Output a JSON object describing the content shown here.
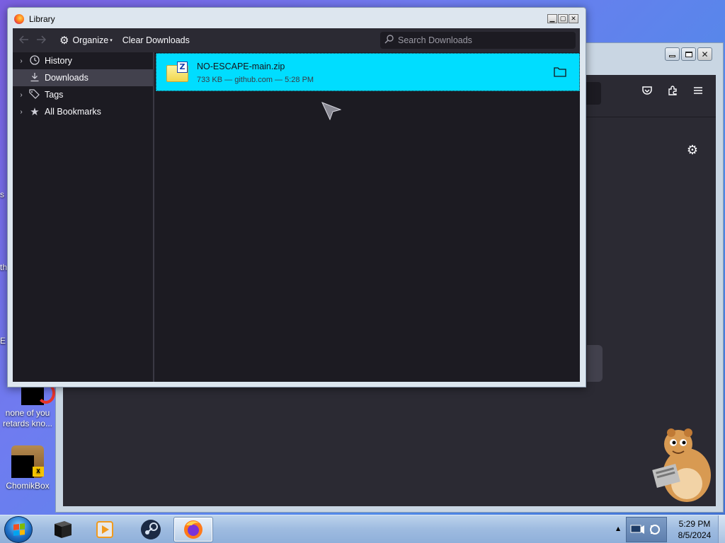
{
  "library_window": {
    "title": "Library",
    "toolbar": {
      "back_icon": "arrow-left-icon",
      "forward_icon": "arrow-right-icon",
      "organize_label": "Organize",
      "clear_downloads_label": "Clear Downloads",
      "search_placeholder": "Search Downloads"
    },
    "sidebar": {
      "items": [
        {
          "label": "History",
          "icon": "clock-icon",
          "expandable": true,
          "selected": false
        },
        {
          "label": "Downloads",
          "icon": "download-icon",
          "expandable": false,
          "selected": true
        },
        {
          "label": "Tags",
          "icon": "tag-icon",
          "expandable": true,
          "selected": false
        },
        {
          "label": "All Bookmarks",
          "icon": "star-icon",
          "expandable": true,
          "selected": false
        }
      ]
    },
    "downloads": [
      {
        "name": "NO-ESCAPE-main.zip",
        "meta": "733 KB — github.com — 5:28 PM",
        "icon": "zip-file-icon",
        "selected_color": "#00ddff"
      }
    ]
  },
  "desktop": {
    "icons": [
      {
        "label": "none of you retards kno..."
      },
      {
        "label": "ChomikBox"
      }
    ],
    "edge_texts": [
      "s",
      "th",
      "E"
    ]
  },
  "taskbar": {
    "clock_time": "5:29 PM",
    "clock_date": "8/5/2024"
  },
  "colors": {
    "accent": "#00ddff",
    "dark_bg": "#1c1b22",
    "toolbar_bg": "#2b2a33"
  }
}
